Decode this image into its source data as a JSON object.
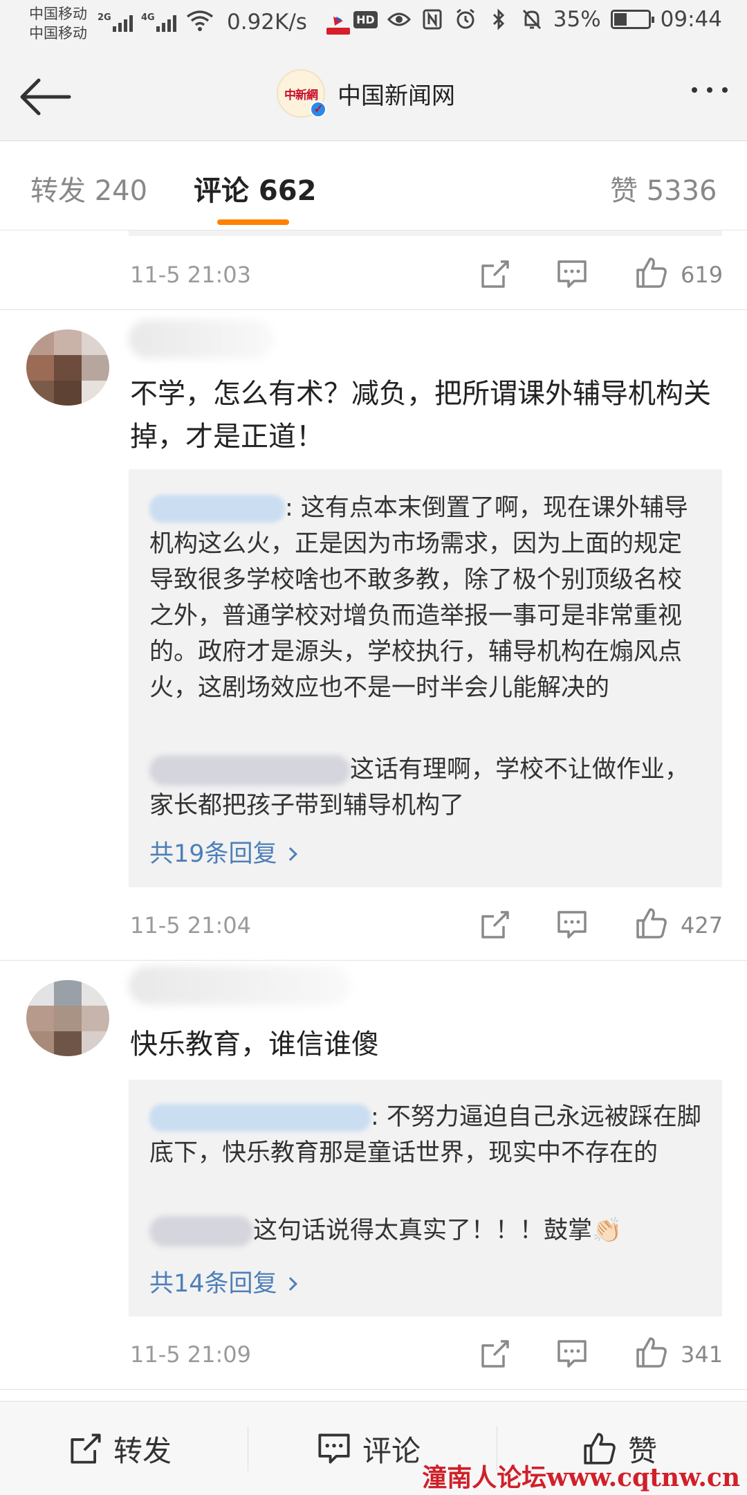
{
  "status_bar": {
    "carrier1": "中国移动",
    "carrier2": "中国移动",
    "net1": "2G",
    "net2": "4G",
    "speed": "0.92K/s",
    "hd": "HD",
    "battery": "35%",
    "time": "09:44"
  },
  "header": {
    "logo_text": "中新網",
    "title": "中国新闻网"
  },
  "tabs": [
    {
      "label": "转发 240"
    },
    {
      "label": "评论 662"
    },
    {
      "label": "赞 5336"
    }
  ],
  "comments": [
    {
      "time": "11-5 21:03",
      "likes": "619"
    },
    {
      "content": "不学，怎么有术？减负，把所谓课外辅导机构关掉，才是正道！",
      "replies": [
        ": 这有点本末倒置了啊，现在课外辅导机构这么火，正是因为市场需求，因为上面的规定导致很多学校啥也不敢多教，除了极个别顶级名校之外，普通学校对增负而造举报一事可是非常重视的。政府才是源头，学校执行，辅导机构在煽风点火，这剧场效应也不是一时半会儿能解决的",
        "这话有理啊，学校不让做作业，家长都把孩子带到辅导机构了"
      ],
      "more_replies": "共19条回复",
      "time": "11-5 21:04",
      "likes": "427"
    },
    {
      "content": "快乐教育，谁信谁傻",
      "replies": [
        ": 不努力逼迫自己永远被踩在脚底下，快乐教育那是童话世界，现实中不存在的",
        "这句话说得太真实了！！！鼓掌👏🏻"
      ],
      "more_replies": "共14条回复",
      "time": "11-5 21:09",
      "likes": "341"
    }
  ],
  "bottom_bar": {
    "repost": "转发",
    "comment": "评论",
    "like": "赞"
  },
  "watermark": "潼南人论坛www.cqtnw.cn",
  "colors": {
    "accent": "#ff8200",
    "link": "#4d7fb8",
    "verify": "#2a8ae6"
  }
}
